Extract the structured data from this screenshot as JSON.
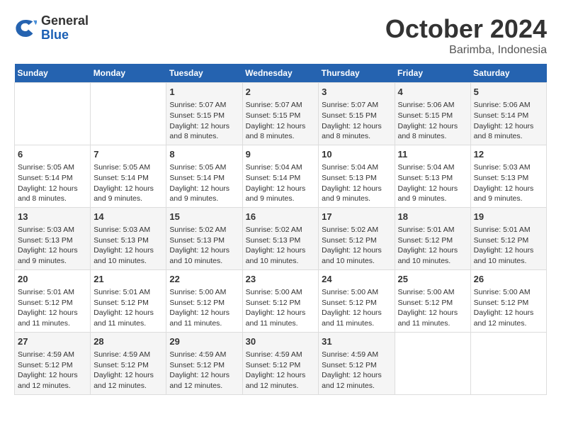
{
  "logo": {
    "general": "General",
    "blue": "Blue"
  },
  "title": "October 2024",
  "location": "Barimba, Indonesia",
  "days_of_week": [
    "Sunday",
    "Monday",
    "Tuesday",
    "Wednesday",
    "Thursday",
    "Friday",
    "Saturday"
  ],
  "weeks": [
    [
      {
        "day": "",
        "content": ""
      },
      {
        "day": "",
        "content": ""
      },
      {
        "day": "1",
        "content": "Sunrise: 5:07 AM\nSunset: 5:15 PM\nDaylight: 12 hours and 8 minutes."
      },
      {
        "day": "2",
        "content": "Sunrise: 5:07 AM\nSunset: 5:15 PM\nDaylight: 12 hours and 8 minutes."
      },
      {
        "day": "3",
        "content": "Sunrise: 5:07 AM\nSunset: 5:15 PM\nDaylight: 12 hours and 8 minutes."
      },
      {
        "day": "4",
        "content": "Sunrise: 5:06 AM\nSunset: 5:15 PM\nDaylight: 12 hours and 8 minutes."
      },
      {
        "day": "5",
        "content": "Sunrise: 5:06 AM\nSunset: 5:14 PM\nDaylight: 12 hours and 8 minutes."
      }
    ],
    [
      {
        "day": "6",
        "content": "Sunrise: 5:05 AM\nSunset: 5:14 PM\nDaylight: 12 hours and 8 minutes."
      },
      {
        "day": "7",
        "content": "Sunrise: 5:05 AM\nSunset: 5:14 PM\nDaylight: 12 hours and 9 minutes."
      },
      {
        "day": "8",
        "content": "Sunrise: 5:05 AM\nSunset: 5:14 PM\nDaylight: 12 hours and 9 minutes."
      },
      {
        "day": "9",
        "content": "Sunrise: 5:04 AM\nSunset: 5:14 PM\nDaylight: 12 hours and 9 minutes."
      },
      {
        "day": "10",
        "content": "Sunrise: 5:04 AM\nSunset: 5:13 PM\nDaylight: 12 hours and 9 minutes."
      },
      {
        "day": "11",
        "content": "Sunrise: 5:04 AM\nSunset: 5:13 PM\nDaylight: 12 hours and 9 minutes."
      },
      {
        "day": "12",
        "content": "Sunrise: 5:03 AM\nSunset: 5:13 PM\nDaylight: 12 hours and 9 minutes."
      }
    ],
    [
      {
        "day": "13",
        "content": "Sunrise: 5:03 AM\nSunset: 5:13 PM\nDaylight: 12 hours and 9 minutes."
      },
      {
        "day": "14",
        "content": "Sunrise: 5:03 AM\nSunset: 5:13 PM\nDaylight: 12 hours and 10 minutes."
      },
      {
        "day": "15",
        "content": "Sunrise: 5:02 AM\nSunset: 5:13 PM\nDaylight: 12 hours and 10 minutes."
      },
      {
        "day": "16",
        "content": "Sunrise: 5:02 AM\nSunset: 5:13 PM\nDaylight: 12 hours and 10 minutes."
      },
      {
        "day": "17",
        "content": "Sunrise: 5:02 AM\nSunset: 5:12 PM\nDaylight: 12 hours and 10 minutes."
      },
      {
        "day": "18",
        "content": "Sunrise: 5:01 AM\nSunset: 5:12 PM\nDaylight: 12 hours and 10 minutes."
      },
      {
        "day": "19",
        "content": "Sunrise: 5:01 AM\nSunset: 5:12 PM\nDaylight: 12 hours and 10 minutes."
      }
    ],
    [
      {
        "day": "20",
        "content": "Sunrise: 5:01 AM\nSunset: 5:12 PM\nDaylight: 12 hours and 11 minutes."
      },
      {
        "day": "21",
        "content": "Sunrise: 5:01 AM\nSunset: 5:12 PM\nDaylight: 12 hours and 11 minutes."
      },
      {
        "day": "22",
        "content": "Sunrise: 5:00 AM\nSunset: 5:12 PM\nDaylight: 12 hours and 11 minutes."
      },
      {
        "day": "23",
        "content": "Sunrise: 5:00 AM\nSunset: 5:12 PM\nDaylight: 12 hours and 11 minutes."
      },
      {
        "day": "24",
        "content": "Sunrise: 5:00 AM\nSunset: 5:12 PM\nDaylight: 12 hours and 11 minutes."
      },
      {
        "day": "25",
        "content": "Sunrise: 5:00 AM\nSunset: 5:12 PM\nDaylight: 12 hours and 11 minutes."
      },
      {
        "day": "26",
        "content": "Sunrise: 5:00 AM\nSunset: 5:12 PM\nDaylight: 12 hours and 12 minutes."
      }
    ],
    [
      {
        "day": "27",
        "content": "Sunrise: 4:59 AM\nSunset: 5:12 PM\nDaylight: 12 hours and 12 minutes."
      },
      {
        "day": "28",
        "content": "Sunrise: 4:59 AM\nSunset: 5:12 PM\nDaylight: 12 hours and 12 minutes."
      },
      {
        "day": "29",
        "content": "Sunrise: 4:59 AM\nSunset: 5:12 PM\nDaylight: 12 hours and 12 minutes."
      },
      {
        "day": "30",
        "content": "Sunrise: 4:59 AM\nSunset: 5:12 PM\nDaylight: 12 hours and 12 minutes."
      },
      {
        "day": "31",
        "content": "Sunrise: 4:59 AM\nSunset: 5:12 PM\nDaylight: 12 hours and 12 minutes."
      },
      {
        "day": "",
        "content": ""
      },
      {
        "day": "",
        "content": ""
      }
    ]
  ]
}
